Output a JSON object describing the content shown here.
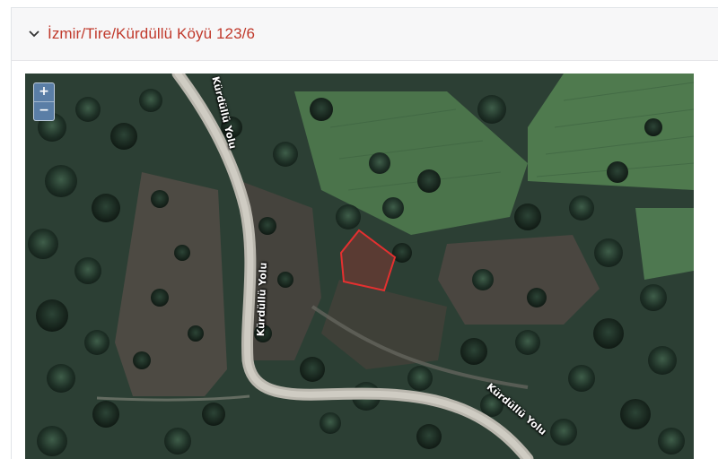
{
  "panel": {
    "title": "İzmir/Tire/Kürdüllü Köyü 123/6",
    "expanded": true,
    "accent_color": "#c0392b"
  },
  "map": {
    "view": "satellite",
    "zoom_controls": {
      "zoom_in": "+",
      "zoom_out": "−"
    },
    "road_labels": [
      "Kürdüllü Yolu",
      "Kürdüllü Yolu",
      "Kürdüllü Yolu"
    ],
    "parcel_outline_color": "#e53030"
  }
}
